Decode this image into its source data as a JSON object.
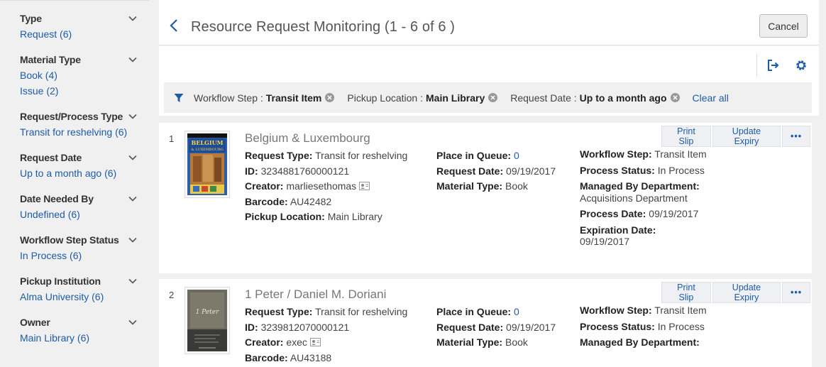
{
  "sidebar": {
    "facets": [
      {
        "title": "Type",
        "values": [
          "Request (6)"
        ]
      },
      {
        "title": "Material Type",
        "values": [
          "Book (4)",
          "Issue (2)"
        ]
      },
      {
        "title": "Request/Process Type",
        "values": [
          "Transit for reshelving (6)"
        ]
      },
      {
        "title": "Request Date",
        "values": [
          "Up to a month ago (6)"
        ]
      },
      {
        "title": "Date Needed By",
        "values": [
          "Undefined (6)"
        ]
      },
      {
        "title": "Workflow Step Status",
        "values": [
          "In Process (6)"
        ]
      },
      {
        "title": "Pickup Institution",
        "values": [
          "Alma University (6)"
        ]
      },
      {
        "title": "Owner",
        "values": [
          "Main Library (6)"
        ]
      }
    ]
  },
  "header": {
    "title": "Resource Request Monitoring (1 - 6 of 6 )",
    "cancel_label": "Cancel"
  },
  "toolbar": {
    "export_icon": "export-icon",
    "settings_icon": "gear-icon"
  },
  "filters": {
    "chips": [
      {
        "label": "Workflow Step :",
        "value": "Transit Item"
      },
      {
        "label": "Pickup Location :",
        "value": "Main Library"
      },
      {
        "label": "Request Date :",
        "value": "Up to a month ago"
      }
    ],
    "clear_all": "Clear all"
  },
  "actions": {
    "print_slip": "Print Slip",
    "update_expiry": "Update Expiry",
    "more": "•••"
  },
  "results": [
    {
      "num": "1",
      "title": "Belgium & Luxembourg",
      "request_type_label": "Request Type:",
      "request_type": "Transit for reshelving",
      "id_label": "ID:",
      "id": "3234881760000121",
      "creator_label": "Creator:",
      "creator": "marliesethomas",
      "barcode_label": "Barcode:",
      "barcode": "AU42482",
      "pickup_label": "Pickup Location:",
      "pickup": "Main Library",
      "queue_label": "Place in Queue:",
      "queue": "0",
      "request_date_label": "Request Date:",
      "request_date": "09/19/2017",
      "material_label": "Material Type:",
      "material": "Book",
      "workflow_label": "Workflow Step:",
      "workflow": "Transit Item",
      "process_status_label": "Process Status:",
      "process_status": "In Process",
      "managed_label": "Managed By Department:",
      "managed": "Acquisitions Department",
      "process_date_label": "Process Date:",
      "process_date": "09/19/2017",
      "expiration_label": "Expiration Date:",
      "expiration": "09/19/2017",
      "cover_text": [
        "BELGIUM",
        "& LUXEMBOURG"
      ]
    },
    {
      "num": "2",
      "title": "1 Peter / Daniel M. Doriani",
      "request_type_label": "Request Type:",
      "request_type": "Transit for reshelving",
      "id_label": "ID:",
      "id": "3239812070000121",
      "creator_label": "Creator:",
      "creator": "exec",
      "barcode_label": "Barcode:",
      "barcode": "AU43188",
      "queue_label": "Place in Queue:",
      "queue": "0",
      "request_date_label": "Request Date:",
      "request_date": "09/19/2017",
      "material_label": "Material Type:",
      "material": "Book",
      "workflow_label": "Workflow Step:",
      "workflow": "Transit Item",
      "process_status_label": "Process Status:",
      "process_status": "In Process",
      "managed_label": "Managed By Department:",
      "cover_text": [
        "1 Peter"
      ]
    }
  ],
  "colors": {
    "link": "#1d5ba8",
    "background": "#f0f0f0"
  }
}
